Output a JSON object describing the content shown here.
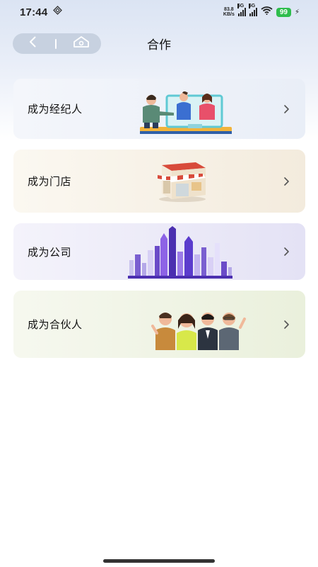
{
  "status_bar": {
    "time": "17:44",
    "net_speed_value": "83.8",
    "net_speed_unit": "KB/s",
    "signal1_label": "5G",
    "signal2_label": "5G",
    "battery": "99"
  },
  "header": {
    "title": "合作"
  },
  "cards": [
    {
      "label": "成为经纪人",
      "illustration": "agents-handshake-illustration"
    },
    {
      "label": "成为门店",
      "illustration": "storefront-illustration"
    },
    {
      "label": "成为公司",
      "illustration": "city-skyline-illustration"
    },
    {
      "label": "成为合伙人",
      "illustration": "partners-group-illustration"
    }
  ],
  "colors": {
    "accent_battery": "#2ebd4c",
    "nav_pill": "#c7d1e0"
  }
}
